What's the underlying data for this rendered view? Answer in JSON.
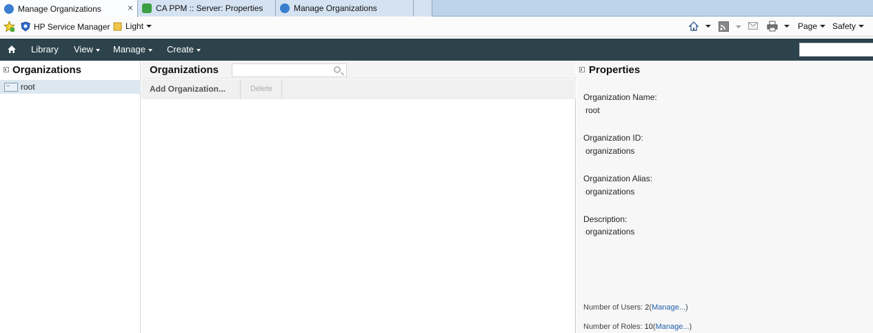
{
  "browser": {
    "tabs": [
      {
        "label": "Manage Organizations",
        "active": true,
        "close": "×"
      },
      {
        "label": "CA PPM :: Server: Properties",
        "active": false
      },
      {
        "label": "Manage Organizations",
        "active": false
      }
    ]
  },
  "favorites": {
    "items": [
      {
        "label": "HP Service Manager",
        "icon": "hp-shield-icon"
      },
      {
        "label": "Light",
        "icon": "folder-icon"
      }
    ]
  },
  "commandbar": {
    "page_label": "Page",
    "safety_label": "Safety"
  },
  "appnav": {
    "library": "Library",
    "view": "View",
    "manage": "Manage",
    "create": "Create"
  },
  "leftpanel": {
    "title": "Organizations",
    "tree": [
      {
        "label": "root"
      }
    ]
  },
  "midpanel": {
    "title": "Organizations",
    "add_button": "Add Organization...",
    "delete_button": "Delete"
  },
  "properties": {
    "title": "Properties",
    "fields": [
      {
        "label": "Organization Name:",
        "value": "root"
      },
      {
        "label": "Organization ID:",
        "value": "organizations"
      },
      {
        "label": "Organization Alias:",
        "value": "organizations"
      },
      {
        "label": "Description:",
        "value": "organizations"
      }
    ],
    "users": {
      "label": "Number of Users:",
      "count": "2",
      "link": "Manage...",
      "open": "(",
      "close": ")"
    },
    "roles": {
      "label": "Number of Roles:",
      "count": "10",
      "link": "Manage...",
      "open": "(",
      "close": ")"
    }
  },
  "colors": {
    "appnav_bg": "#2d434c",
    "link": "#1f5fa8",
    "selection": "#dce7ef"
  }
}
